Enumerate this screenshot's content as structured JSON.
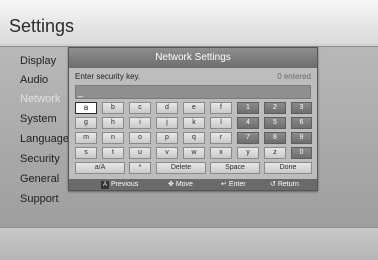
{
  "screen": {
    "title": "Settings",
    "menu": [
      "Display",
      "Audio",
      "Network",
      "System",
      "Language",
      "Security",
      "General",
      "Support"
    ]
  },
  "dialog": {
    "title": "Network Settings",
    "prompt": "Enter security key.",
    "count": "0 entered",
    "input_value": "_",
    "keys": {
      "row1": [
        "a",
        "b",
        "c",
        "d",
        "e",
        "f",
        "1",
        "2",
        "3"
      ],
      "row2": [
        "g",
        "h",
        "i",
        "j",
        "k",
        "l",
        "4",
        "5",
        "6"
      ],
      "row3": [
        "m",
        "n",
        "o",
        "p",
        "q",
        "r",
        "7",
        "8",
        "9"
      ],
      "row4": [
        "s",
        "t",
        "u",
        "v",
        "w",
        "x",
        "y",
        "z",
        "0"
      ],
      "bottom": [
        "a/A",
        "*",
        "Delete",
        "Space",
        "Done"
      ]
    },
    "hints": {
      "previous_button": "A",
      "previous": "Previous",
      "move": "Move",
      "enter": "Enter",
      "return": "Return"
    }
  },
  "icons": [
    "move-icon",
    "enter-icon",
    "return-icon"
  ],
  "colors": {
    "dialog_header": "#7a7a7a",
    "key_light": "#d9d9d9",
    "key_dark": "#777777",
    "selected_key": "#ffffff"
  }
}
